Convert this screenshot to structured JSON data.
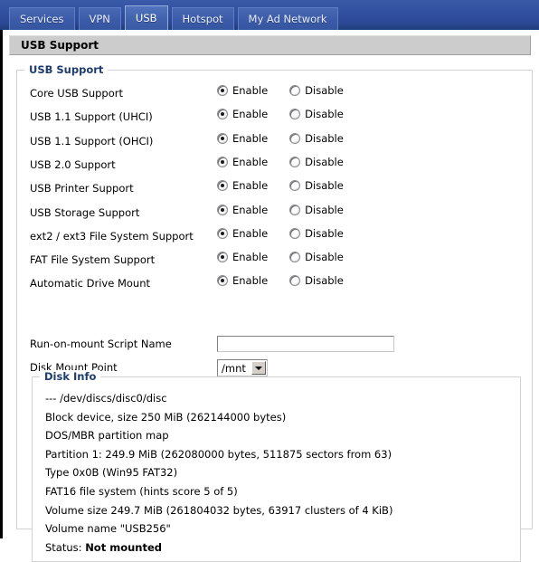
{
  "tabs": [
    {
      "label": "Services",
      "selected": false
    },
    {
      "label": "VPN",
      "selected": false
    },
    {
      "label": "USB",
      "selected": true
    },
    {
      "label": "Hotspot",
      "selected": false
    },
    {
      "label": "My Ad Network",
      "selected": false
    }
  ],
  "page": {
    "title": "USB Support"
  },
  "usb_fieldset": {
    "legend": "USB Support",
    "enable_label": "Enable",
    "disable_label": "Disable",
    "rows": [
      {
        "label": "Core USB Support",
        "value": "Enable"
      },
      {
        "label": "USB 1.1 Support (UHCI)",
        "value": "Enable"
      },
      {
        "label": "USB 1.1 Support (OHCI)",
        "value": "Enable"
      },
      {
        "label": "USB 2.0 Support",
        "value": "Enable"
      },
      {
        "label": "USB Printer Support",
        "value": "Enable"
      },
      {
        "label": "USB Storage Support",
        "value": "Enable"
      },
      {
        "label": "ext2 / ext3 File System Support",
        "value": "Enable"
      },
      {
        "label": "FAT File System Support",
        "value": "Enable"
      },
      {
        "label": "Automatic Drive Mount",
        "value": "Enable"
      }
    ],
    "script_name": {
      "label": "Run-on-mount Script Name",
      "value": "",
      "placeholder": ""
    },
    "mount_point": {
      "label": "Disk Mount Point",
      "value": "/mnt"
    }
  },
  "disk_info": {
    "legend": "Disk Info",
    "lines": [
      {
        "text": "--- /dev/discs/disc0/disc",
        "bold_tail": ""
      },
      {
        "text": "Block device, size 250 MiB (262144000 bytes)",
        "bold_tail": ""
      },
      {
        "text": "DOS/MBR partition map",
        "bold_tail": ""
      },
      {
        "text": "Partition 1: 249.9 MiB (262080000 bytes, 511875 sectors from 63)",
        "bold_tail": ""
      },
      {
        "text": "Type 0x0B (Win95 FAT32)",
        "bold_tail": ""
      },
      {
        "text": "FAT16 file system (hints score 5 of 5)",
        "bold_tail": ""
      },
      {
        "text": "Volume size 249.7 MiB (261804032 bytes, 63917 clusters of 4 KiB)",
        "bold_tail": ""
      },
      {
        "text": "Volume name \"USB256\"",
        "bold_tail": ""
      },
      {
        "text": "Status: ",
        "bold_tail": "Not mounted"
      }
    ]
  },
  "colors": {
    "tabbar_blue": "#2f4f9e",
    "tab_selected_border": "#93aadd",
    "legend_navy": "#1f3c6e",
    "title_bar_gray": "#cccccc"
  }
}
